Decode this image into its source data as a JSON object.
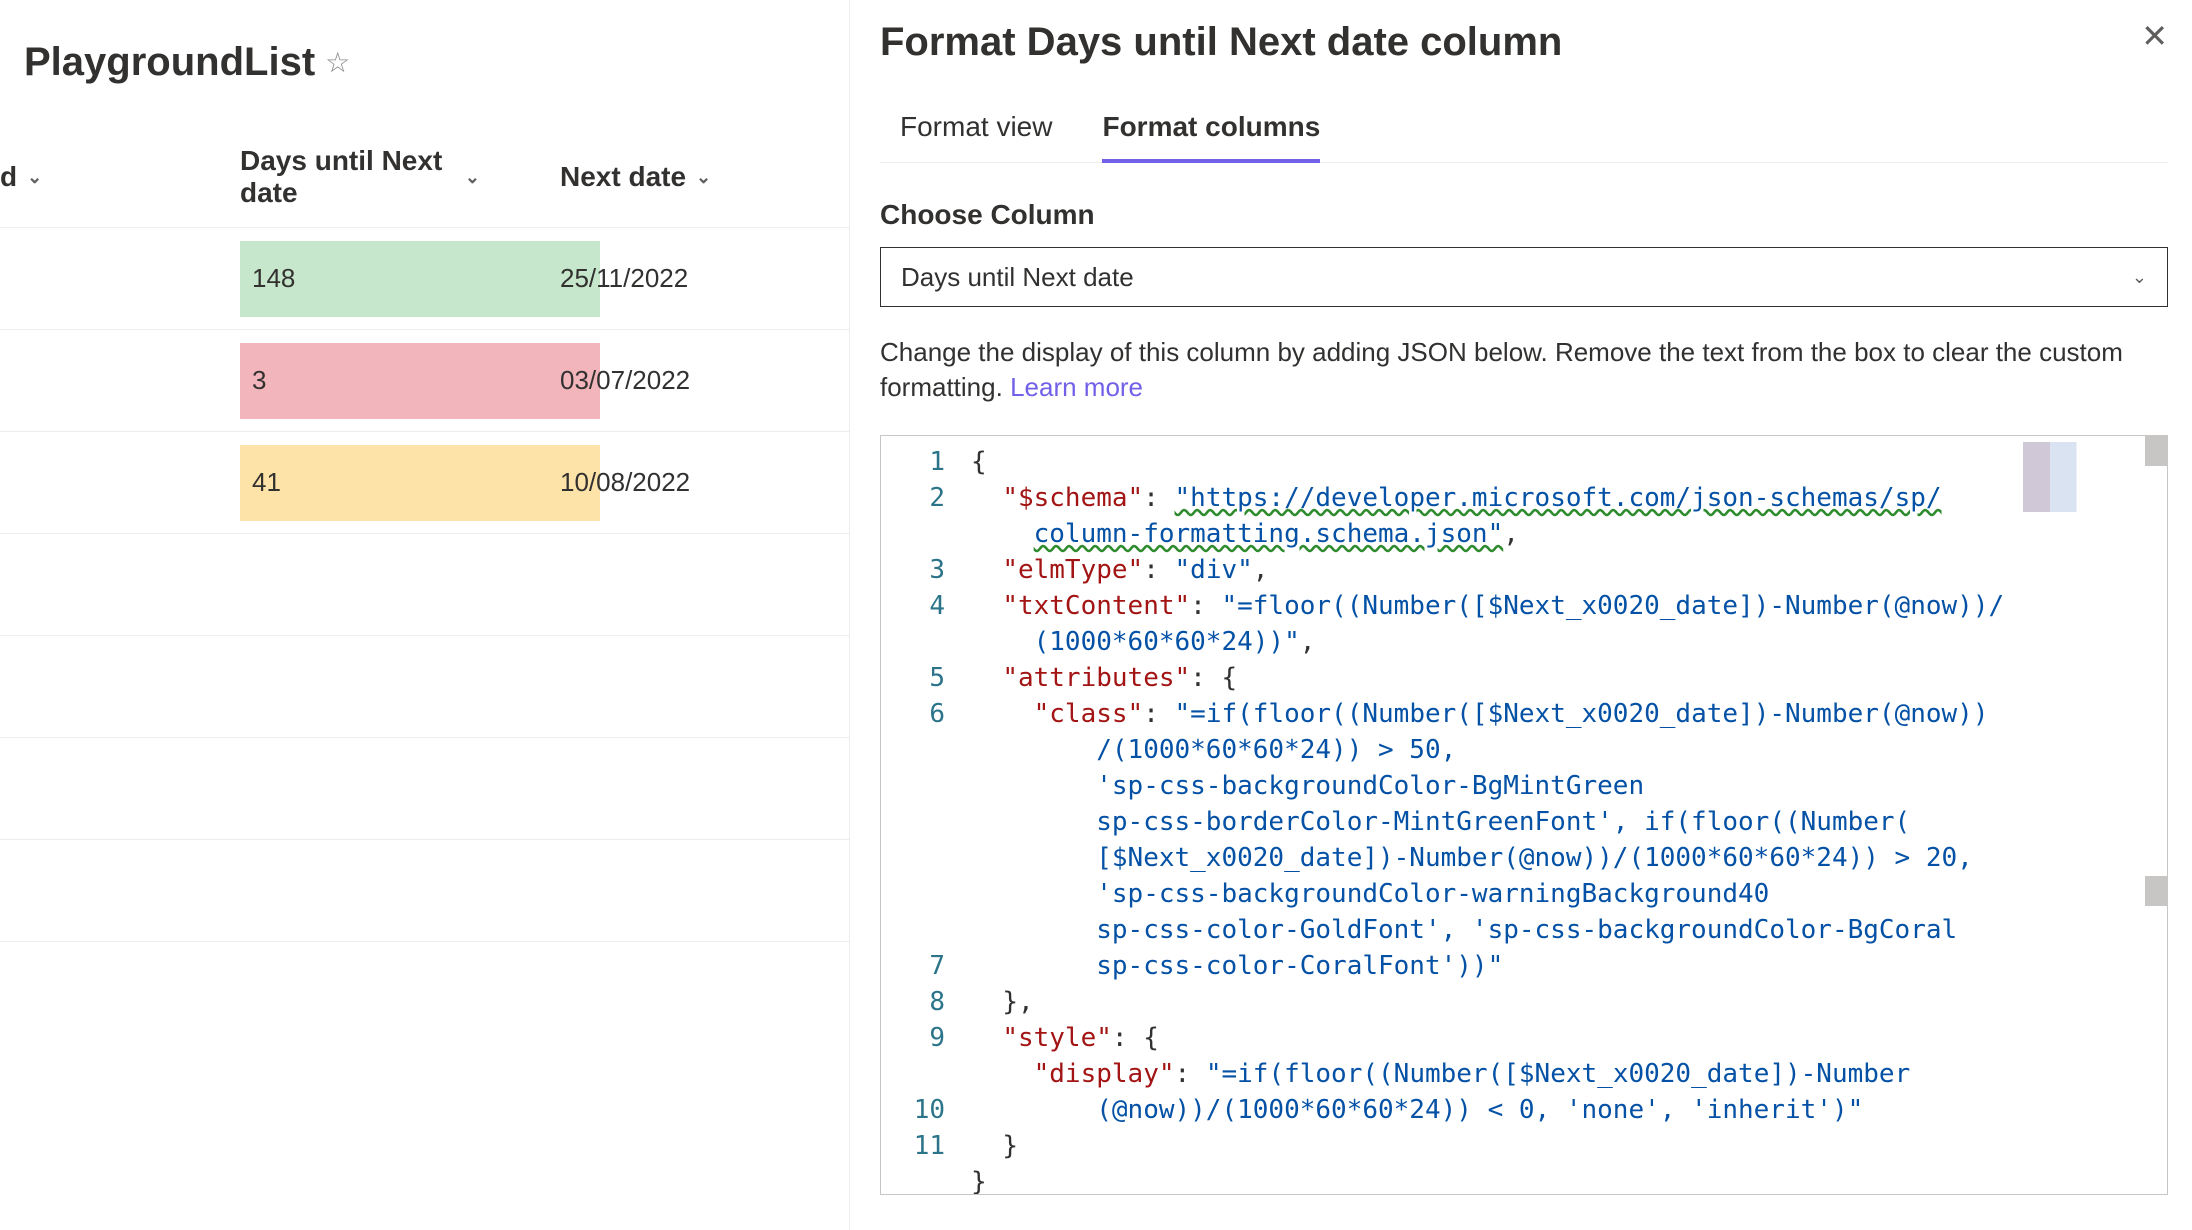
{
  "list": {
    "title": "PlaygroundList",
    "columns": {
      "id_label": "d",
      "days_label": "Days until Next date",
      "next_label": "Next date"
    },
    "rows": [
      {
        "days": "148",
        "days_class": "bg-mint",
        "next": "25/11/2022"
      },
      {
        "days": "3",
        "days_class": "bg-coral",
        "next": "03/07/2022"
      },
      {
        "days": "41",
        "days_class": "bg-warn",
        "next": "10/08/2022"
      }
    ]
  },
  "panel": {
    "title": "Format Days until Next date column",
    "tabs": {
      "view": "Format view",
      "columns": "Format columns"
    },
    "choose_label": "Choose Column",
    "selected_column": "Days until Next date",
    "desc_prefix": "Change the display of this column by adding JSON below. Remove the text from the box to clear the custom formatting. ",
    "learn_more": "Learn more"
  },
  "editor": {
    "line_numbers": [
      "1",
      "2",
      "3",
      "4",
      "5",
      "6",
      "7",
      "8",
      "9",
      "10",
      "11"
    ],
    "json_source": {
      "$schema": "https://developer.microsoft.com/json-schemas/sp/column-formatting.schema.json",
      "elmType": "div",
      "txtContent": "=floor((Number([$Next_x0020_date])-Number(@now))/(1000*60*60*24))",
      "attributes": {
        "class": "=if(floor((Number([$Next_x0020_date])-Number(@now))/(1000*60*60*24)) > 50, 'sp-css-backgroundColor-BgMintGreen sp-css-borderColor-MintGreenFont', if(floor((Number([$Next_x0020_date])-Number(@now))/(1000*60*60*24)) > 20, 'sp-css-backgroundColor-warningBackground40 sp-css-color-GoldFont', 'sp-css-backgroundColor-BgCoral sp-css-color-CoralFont'))"
      },
      "style": {
        "display": "=if(floor((Number([$Next_x0020_date])-Number(@now))/(1000*60*60*24)) < 0, 'none', 'inherit')"
      }
    },
    "display_lines": {
      "l1": "{",
      "l2a_key": "\"$schema\"",
      "l2a_val": "\"https://developer.microsoft.com/json-schemas/sp/",
      "l2b_val": "column-formatting.schema.json\"",
      "l3_key": "\"elmType\"",
      "l3_val": "\"div\"",
      "l4_key": "\"txtContent\"",
      "l4_val": "\"=floor((Number([$Next_x0020_date])-Number(@now))/",
      "l4b_val": "(1000*60*60*24))\"",
      "l5_key": "\"attributes\"",
      "l6_key": "\"class\"",
      "l6_val1": "\"=if(floor((Number([$Next_x0020_date])-Number(@now))",
      "l6_val2": "/(1000*60*60*24)) > 50, ",
      "l6_val3": "'sp-css-backgroundColor-BgMintGreen ",
      "l6_val4": "sp-css-borderColor-MintGreenFont', if(floor((Number(",
      "l6_val5": "[$Next_x0020_date])-Number(@now))/(1000*60*60*24)) > 20, ",
      "l6_val6": "'sp-css-backgroundColor-warningBackground40 ",
      "l6_val7": "sp-css-color-GoldFont', 'sp-css-backgroundColor-BgCoral ",
      "l6_val8": "sp-css-color-CoralFont'))\"",
      "l8_key": "\"style\"",
      "l9_key": "\"display\"",
      "l9_val1": "\"=if(floor((Number([$Next_x0020_date])-Number",
      "l9_val2": "(@now))/(1000*60*60*24)) < 0, 'none', 'inherit')\""
    }
  },
  "colors": {
    "accent": "#7160e8",
    "mint": "#c7e7cc",
    "coral": "#f2b5bc",
    "warn": "#fde3a8"
  }
}
